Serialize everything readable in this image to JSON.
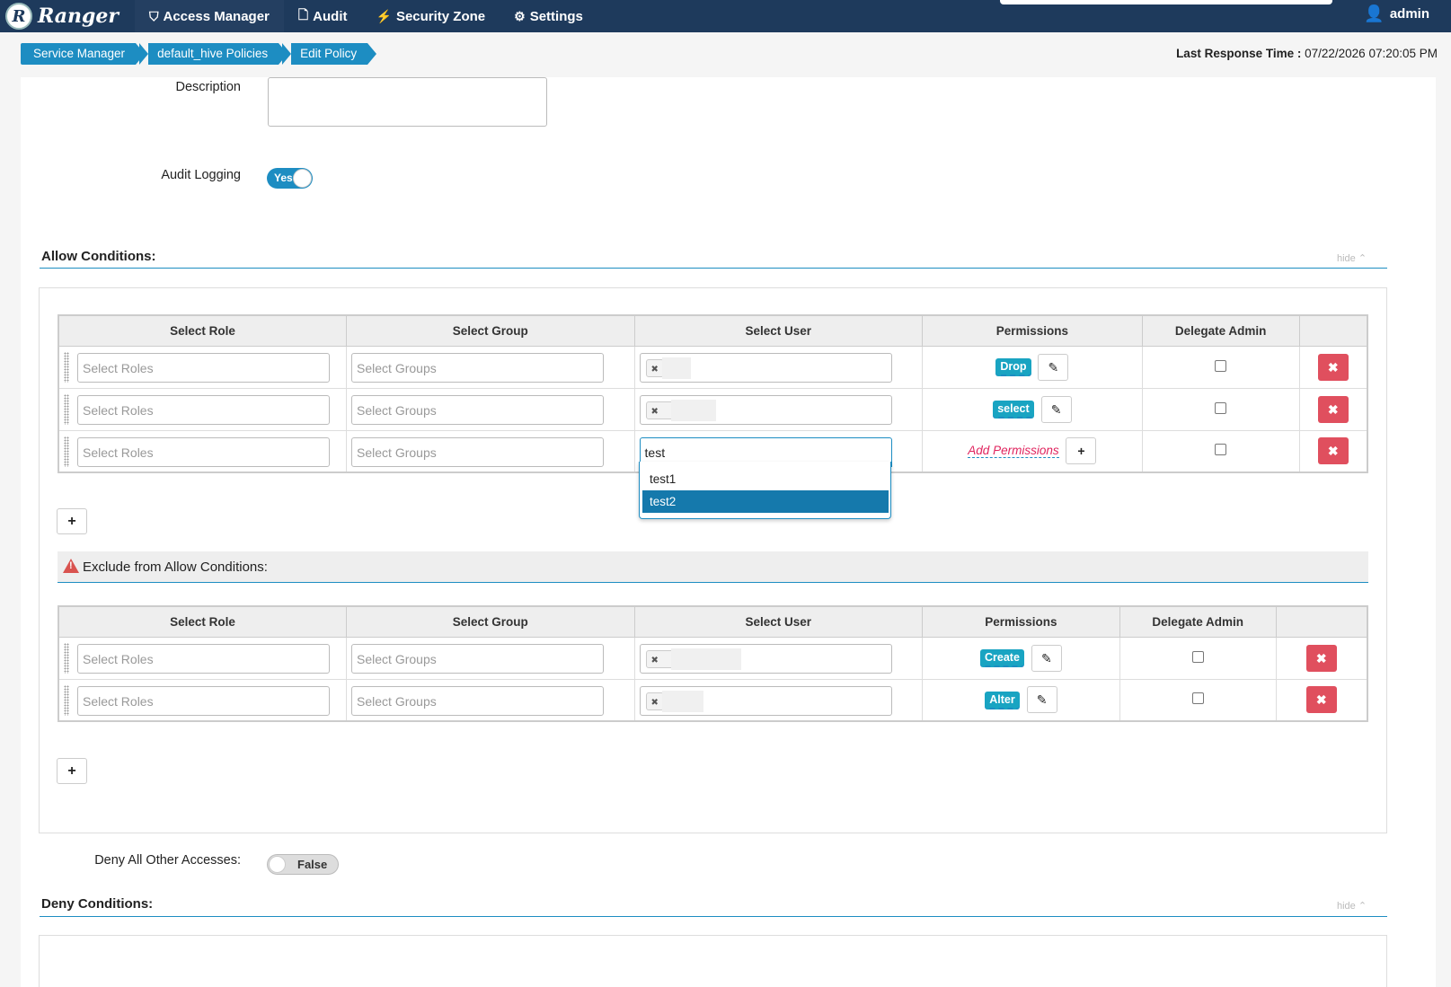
{
  "nav": {
    "brand": "Ranger",
    "brand_icon": "R",
    "items": [
      {
        "label": "Access Manager",
        "icon": "shield-icon"
      },
      {
        "label": "Audit",
        "icon": "file-icon"
      },
      {
        "label": "Security Zone",
        "icon": "bolt-file-icon"
      },
      {
        "label": "Settings",
        "icon": "gear-icon"
      }
    ],
    "user": "admin"
  },
  "breadcrumb": [
    "Service Manager",
    "default_hive Policies",
    "Edit Policy"
  ],
  "last_response": {
    "label": "Last Response Time :",
    "value": "07/22/2026 07:20:05 PM"
  },
  "form": {
    "description_label": "Description",
    "audit_label": "Audit Logging",
    "audit_value": "Yes",
    "deny_all_label": "Deny All Other Accesses:",
    "deny_all_value": "False"
  },
  "allow": {
    "title": "Allow Conditions:",
    "hide": "hide",
    "headers": [
      "Select Role",
      "Select Group",
      "Select User",
      "Permissions",
      "Delegate Admin"
    ],
    "role_placeholder": "Select Roles",
    "group_placeholder": "Select Groups",
    "rows": [
      {
        "permission": "Drop"
      },
      {
        "permission": "select"
      },
      {
        "user_input": "test",
        "add_permissions": "Add Permissions"
      }
    ],
    "dropdown": [
      "test1",
      "test2"
    ]
  },
  "exclude": {
    "title": "Exclude from Allow Conditions:",
    "headers": [
      "Select Role",
      "Select Group",
      "Select User",
      "Permissions",
      "Delegate Admin"
    ],
    "rows": [
      {
        "permission": "Create"
      },
      {
        "permission": "Alter"
      }
    ]
  },
  "deny": {
    "title": "Deny Conditions:",
    "hide": "hide"
  },
  "colors": {
    "nav": "#1e3a5c",
    "accent": "#1d8dc2",
    "danger": "#e04f5e",
    "badge": "#19a4c2"
  }
}
